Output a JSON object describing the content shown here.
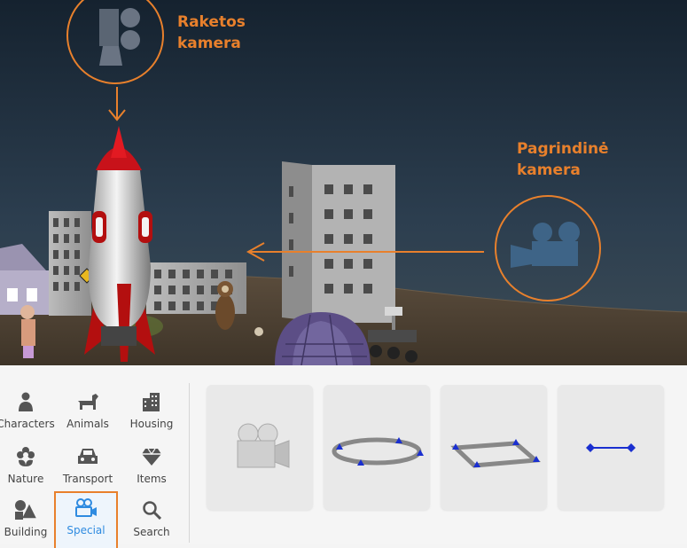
{
  "annotations": {
    "rocket_camera": {
      "line1": "Raketos",
      "line2": "kamera"
    },
    "main_camera": {
      "line1": "Pagrindinė",
      "line2": "kamera"
    }
  },
  "colors": {
    "annotation": "#e8802c",
    "selected_category": "#2f8be0",
    "sky_top": "#1c2c3c",
    "ground": "#4c4032",
    "camera_icon": "#3e6487"
  },
  "categories": [
    {
      "label": "Characters",
      "icon": "person-icon"
    },
    {
      "label": "Animals",
      "icon": "dog-icon"
    },
    {
      "label": "Housing",
      "icon": "buildings-icon"
    },
    {
      "label": "Nature",
      "icon": "flower-icon"
    },
    {
      "label": "Transport",
      "icon": "car-icon"
    },
    {
      "label": "Items",
      "icon": "diamond-icon"
    },
    {
      "label": "Building",
      "icon": "shapes-icon"
    },
    {
      "label": "Special",
      "icon": "camera-icon",
      "selected": true
    },
    {
      "label": "Search",
      "icon": "search-icon"
    }
  ],
  "tiles": [
    {
      "icon": "camera-object-icon"
    },
    {
      "icon": "ellipse-path-icon"
    },
    {
      "icon": "rectangle-path-icon"
    },
    {
      "icon": "line-path-icon"
    }
  ]
}
